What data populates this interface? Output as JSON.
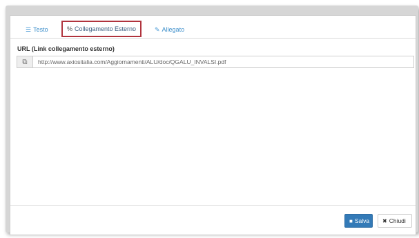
{
  "tabs": [
    {
      "label": "Testo",
      "icon": "text-align-icon"
    },
    {
      "label": "Collegamento Esterno",
      "icon": "link-icon",
      "active": true
    },
    {
      "label": "Allegato",
      "icon": "paperclip-icon"
    }
  ],
  "url_field": {
    "label": "URL (Link collegamento esterno)",
    "value": "http://www.axiositalia.com/Aggiornamenti/ALU/doc/QGALU_INVALSI.pdf",
    "addon_icon": "external-link-icon"
  },
  "footer": {
    "save_label": "Salva",
    "save_icon": "floppy-disk-icon",
    "close_label": "Chiudi",
    "close_icon": "close-icon"
  },
  "colors": {
    "accent": "#337ab7",
    "active_tab_border": "#b0333d",
    "tab_text": "#3d8fcb"
  }
}
